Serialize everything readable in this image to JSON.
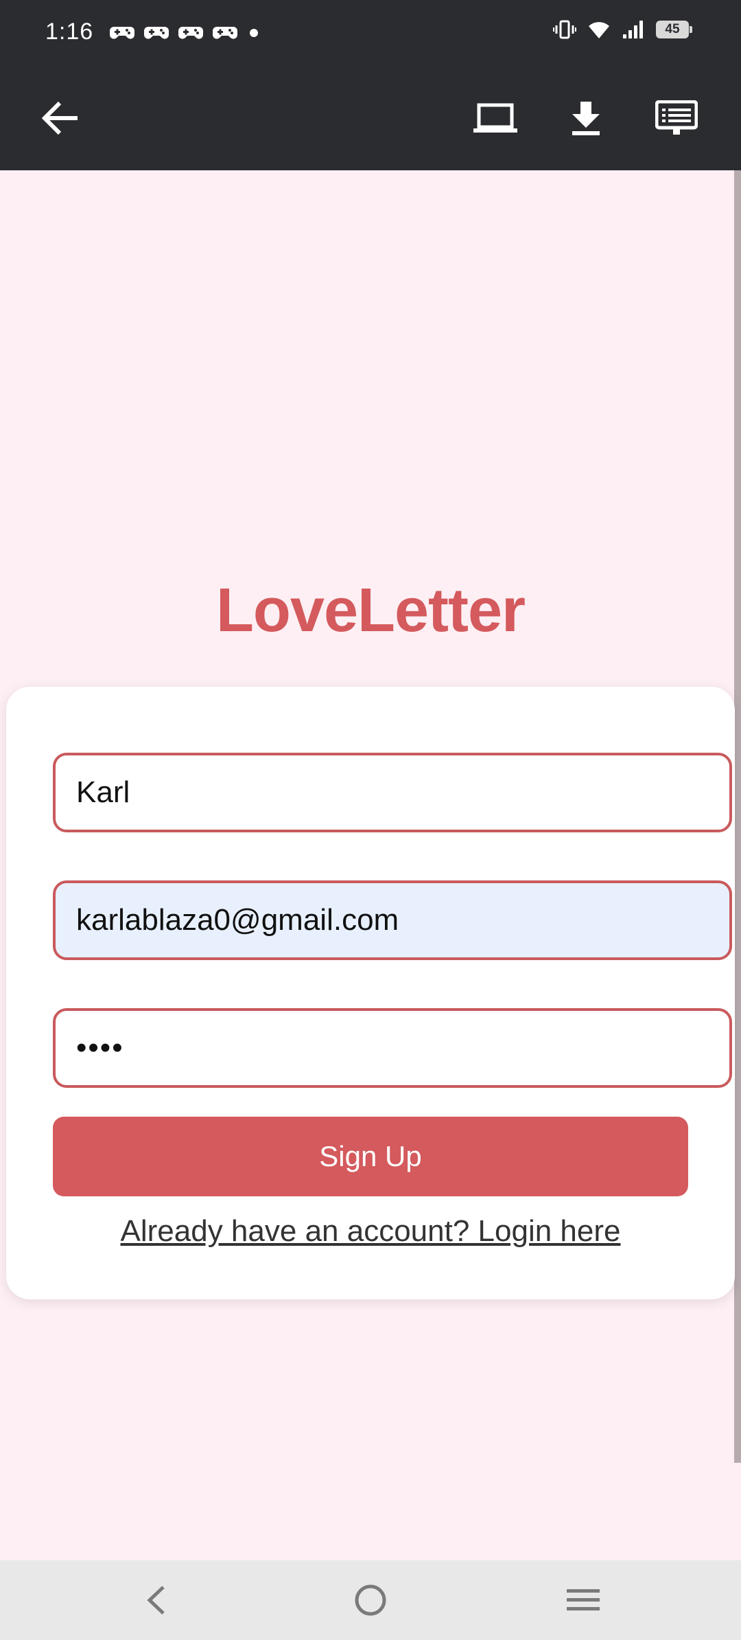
{
  "status_bar": {
    "time": "1:16",
    "notification_icons": [
      "game-controller-icon",
      "game-controller-icon",
      "game-controller-icon",
      "game-controller-icon",
      "more-dot-icon"
    ],
    "battery_level": "45",
    "system_icons": [
      "vibrate-icon",
      "wifi-icon",
      "signal-icon",
      "battery-icon"
    ]
  },
  "toolbar": {
    "icons": [
      "back-arrow-icon",
      "laptop-icon",
      "download-icon",
      "screen-list-icon"
    ]
  },
  "app": {
    "title": "LoveLetter",
    "name_field": {
      "value": "Karl"
    },
    "email_field": {
      "value": "karlablaza0@gmail.com"
    },
    "password_field": {
      "value": "••••"
    },
    "signup_label": "Sign Up",
    "login_link": "Already have an account? Login here"
  },
  "colors": {
    "brand": "#d45a5d",
    "page_background": "#fdeff3",
    "bar_dark": "#2b2c30",
    "autofill": "#e8f0fe"
  },
  "nav_bar": {
    "icons": [
      "nav-back-icon",
      "nav-home-icon",
      "nav-menu-icon"
    ]
  }
}
